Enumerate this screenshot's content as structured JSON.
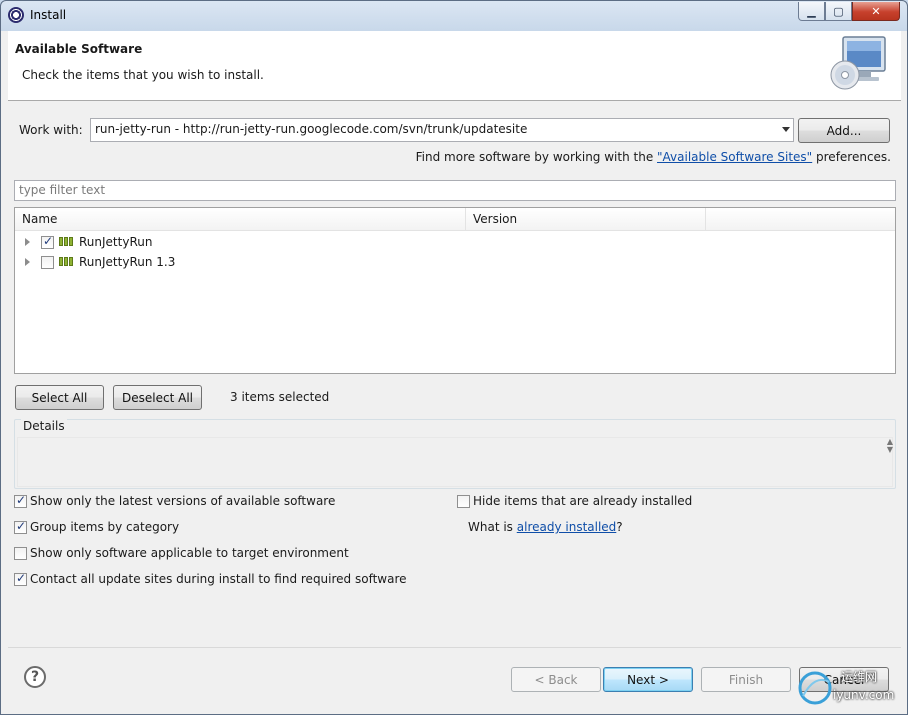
{
  "window": {
    "title": "Install"
  },
  "header": {
    "title": "Available Software",
    "description": "Check the items that you wish to install."
  },
  "work_with": {
    "label": "Work with:",
    "value": "run-jetty-run - http://run-jetty-run.googlecode.com/svn/trunk/updatesite",
    "add_button": "Add..."
  },
  "find_more": {
    "prefix": "Find more software by working with the ",
    "link": "\"Available Software Sites\"",
    "suffix": " preferences."
  },
  "filter": {
    "placeholder": "type filter text"
  },
  "tree": {
    "columns": [
      "Name",
      "Version",
      ""
    ],
    "rows": [
      {
        "label": "RunJettyRun",
        "checked": true
      },
      {
        "label": "RunJettyRun 1.3",
        "checked": false
      }
    ]
  },
  "selection": {
    "select_all": "Select All",
    "deselect_all": "Deselect All",
    "count_text": "3 items selected"
  },
  "details": {
    "title": "Details"
  },
  "options": {
    "latest_versions": {
      "label": "Show only the latest versions of available software",
      "checked": true
    },
    "group_by_category": {
      "label": "Group items by category",
      "checked": true
    },
    "target_env": {
      "label": "Show only software applicable to target environment",
      "checked": false
    },
    "contact_sites": {
      "label": "Contact all update sites during install to find required software",
      "checked": true
    },
    "hide_installed": {
      "label": "Hide items that are already installed",
      "checked": false
    },
    "what_is": {
      "prefix": "What is ",
      "link": "already installed",
      "suffix": "?"
    }
  },
  "footer": {
    "back": "< Back",
    "next": "Next >",
    "finish": "Finish",
    "cancel": "Cancel"
  },
  "watermark": {
    "line1": "运维网",
    "line2": "iyunv.com"
  }
}
